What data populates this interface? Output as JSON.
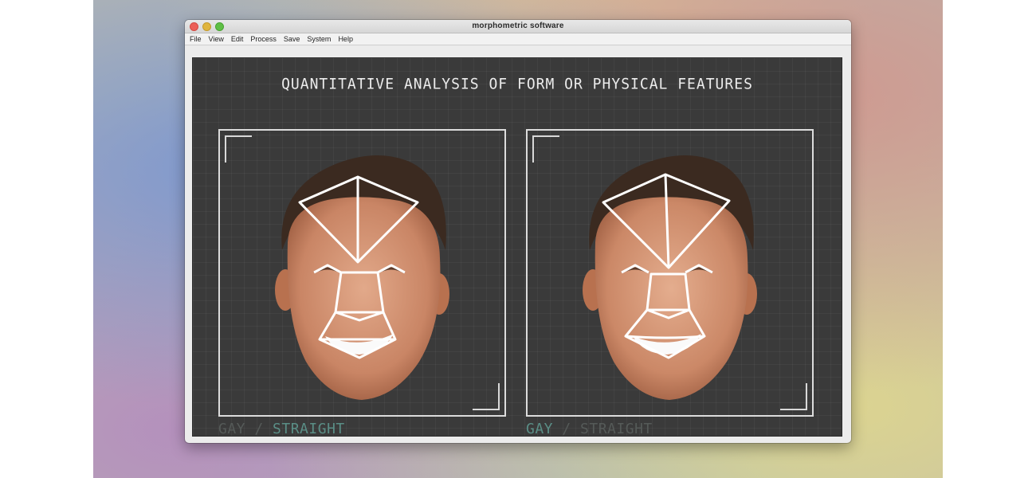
{
  "window": {
    "title": "morphometric software"
  },
  "menu": {
    "items": [
      "File",
      "View",
      "Edit",
      "Process",
      "Save",
      "System",
      "Help"
    ]
  },
  "canvas": {
    "heading": "QUANTITATIVE ANALYSIS OF FORM OR PHYSICAL FEATURES"
  },
  "panels": [
    {
      "option_a": "GAY",
      "separator": "/",
      "option_b": "STRAIGHT",
      "highlighted": "STRAIGHT"
    },
    {
      "option_a": "GAY",
      "separator": "/",
      "option_b": "STRAIGHT",
      "highlighted": "GAY"
    }
  ],
  "colors": {
    "canvas_bg": "#3a3a3a",
    "overlay_lines": "#ffffff",
    "highlight_text": "#5a8e86",
    "dim_text": "#555a58"
  },
  "icons": [
    "close-window-icon",
    "minimize-window-icon",
    "maximize-window-icon",
    "face-portrait-icon",
    "facial-landmark-overlay-icon"
  ]
}
